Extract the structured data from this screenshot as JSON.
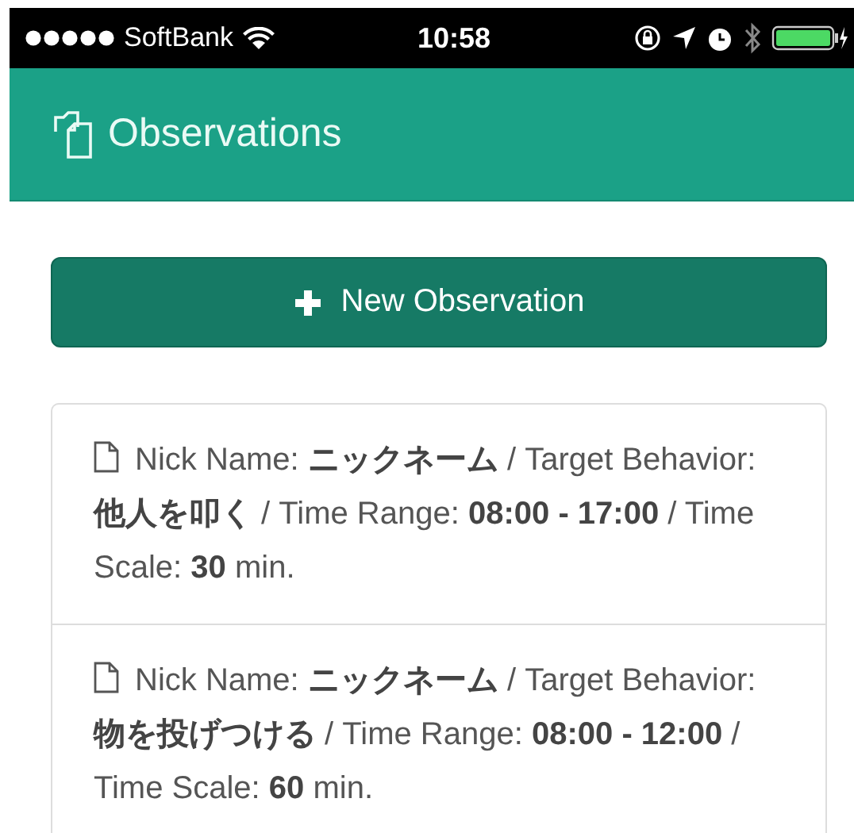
{
  "status_bar": {
    "carrier": "SoftBank",
    "time": "10:58"
  },
  "header": {
    "title": "Observations"
  },
  "new_button": {
    "label": "New Observation"
  },
  "observations": [
    {
      "text": "Nick Name: **ニックネーム** / Target Behavior: **他人を叩く** / Time Range: **08:00 - 17:00** / Time Scale: **30** min."
    },
    {
      "text": "Nick Name: **ニックネーム** / Target Behavior: **物を投げつける** / Time Range: **08:00 - 12:00** / Time Scale: **60** min."
    }
  ]
}
